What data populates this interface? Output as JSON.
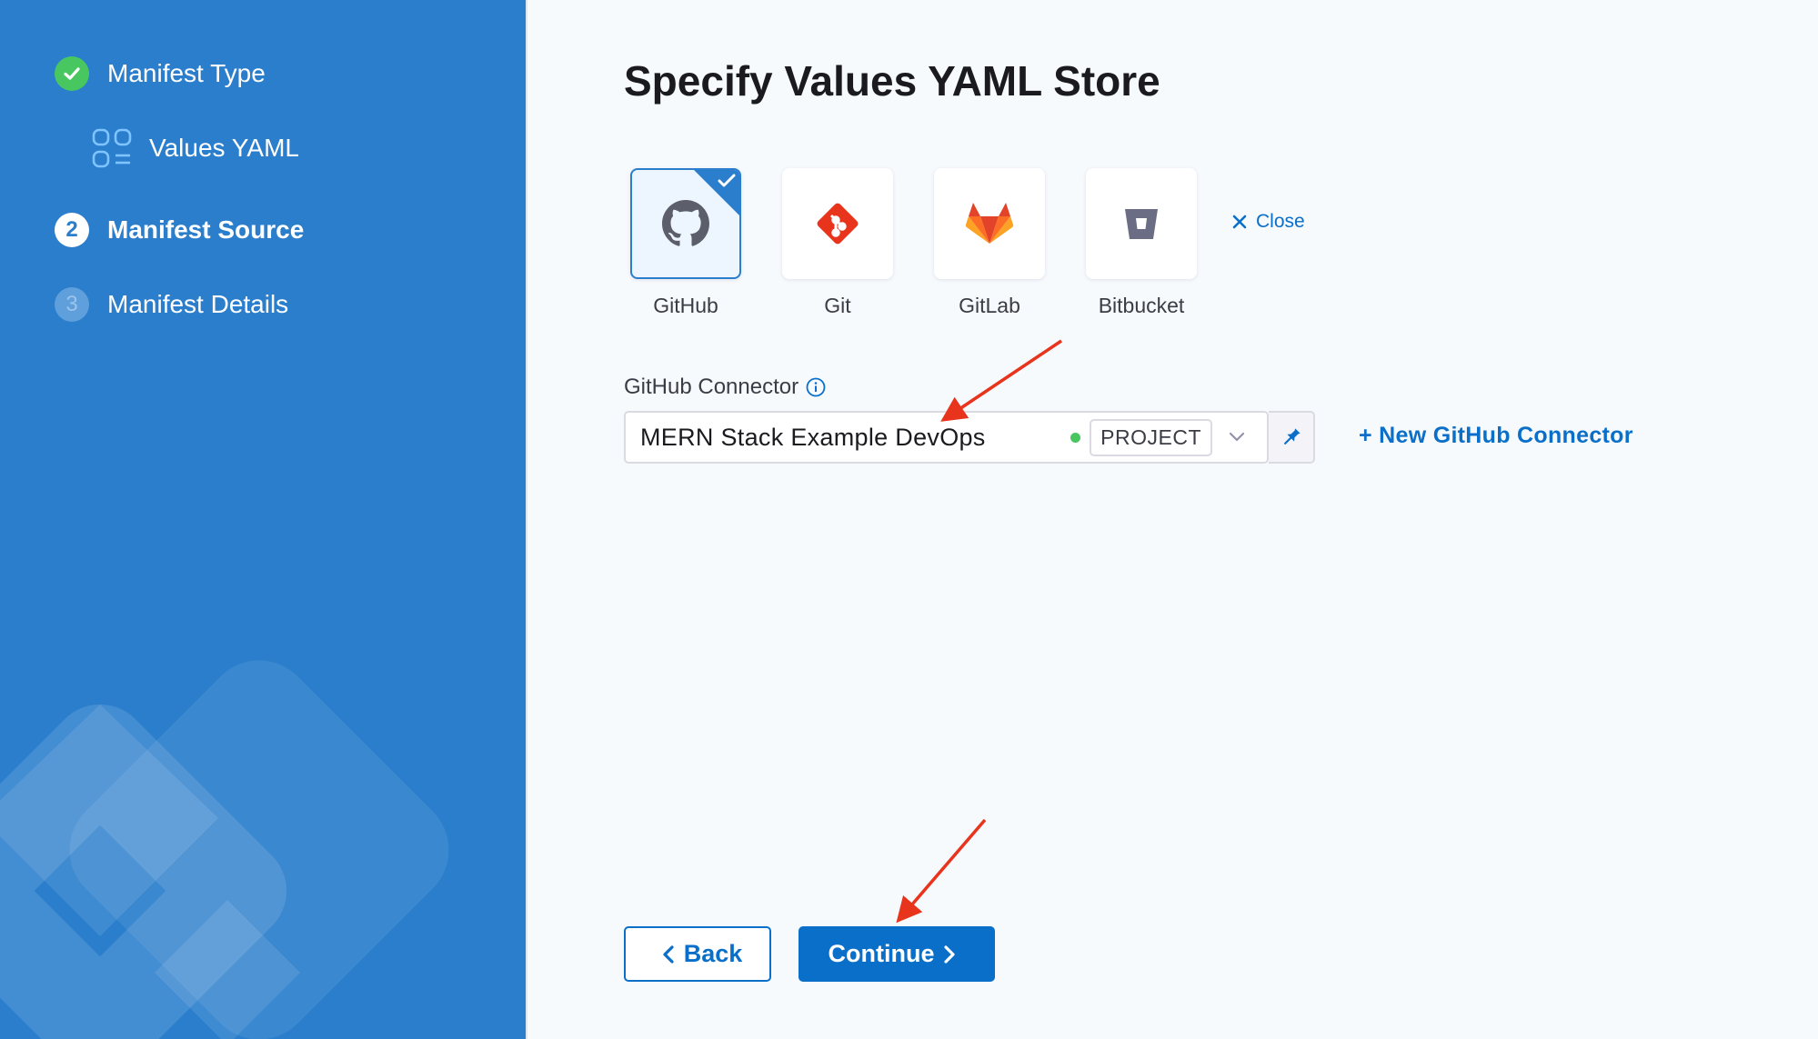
{
  "sidebar": {
    "steps": [
      {
        "label": "Manifest Type",
        "state": "done",
        "badge": ""
      },
      {
        "label": "Values YAML",
        "state": "substep",
        "icon": "values-yaml-icon"
      },
      {
        "label": "Manifest Source",
        "state": "active",
        "badge": "2"
      },
      {
        "label": "Manifest Details",
        "state": "pending",
        "badge": "3"
      }
    ]
  },
  "main": {
    "title": "Specify Values YAML Store",
    "stores": [
      {
        "label": "GitHub",
        "icon": "github-icon",
        "selected": true
      },
      {
        "label": "Git",
        "icon": "git-icon",
        "selected": false
      },
      {
        "label": "GitLab",
        "icon": "gitlab-icon",
        "selected": false
      },
      {
        "label": "Bitbucket",
        "icon": "bitbucket-icon",
        "selected": false
      }
    ],
    "close_label": "Close",
    "connector": {
      "label": "GitHub Connector",
      "value": "MERN Stack Example DevOps",
      "scope": "PROJECT",
      "status_color": "#48c760"
    },
    "new_connector_label": "+ New GitHub Connector",
    "back_label": "Back",
    "continue_label": "Continue"
  },
  "colors": {
    "sidebar_bg": "#2a7ecc",
    "accent": "#0a6fc9",
    "success": "#48c760",
    "annotation_arrow": "#e8341c"
  }
}
